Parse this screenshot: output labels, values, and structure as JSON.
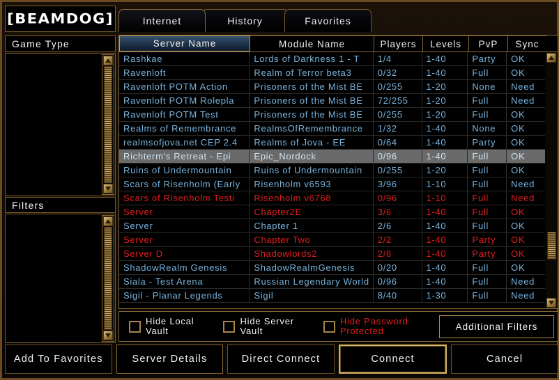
{
  "brand": {
    "logo_text": "[BEAMDOG]"
  },
  "tabs": [
    {
      "label": "Internet",
      "active": true
    },
    {
      "label": "History",
      "active": false
    },
    {
      "label": "Favorites",
      "active": false
    }
  ],
  "sidebar": {
    "game_type_title": "Game Type",
    "filters_title": "Filters"
  },
  "table": {
    "columns": [
      {
        "key": "name",
        "label": "Server Name",
        "sorted": true
      },
      {
        "key": "module",
        "label": "Module Name",
        "sorted": false
      },
      {
        "key": "players",
        "label": "Players",
        "sorted": false
      },
      {
        "key": "levels",
        "label": "Levels",
        "sorted": false
      },
      {
        "key": "pvp",
        "label": "PvP",
        "sorted": false
      },
      {
        "key": "sync",
        "label": "Sync",
        "sorted": false
      }
    ],
    "rows": [
      {
        "name": "Rashkae",
        "module": "Lords of Darkness 1 - T",
        "players": "1/4",
        "levels": "1-40",
        "pvp": "Party",
        "sync": "OK",
        "red": false,
        "selected": false
      },
      {
        "name": "Ravenloft",
        "module": "Realm of Terror beta3",
        "players": "0/32",
        "levels": "1-40",
        "pvp": "Full",
        "sync": "OK",
        "red": false,
        "selected": false
      },
      {
        "name": "Ravenloft POTM Action",
        "module": "Prisoners of the Mist BE",
        "players": "0/255",
        "levels": "1-20",
        "pvp": "None",
        "sync": "Need",
        "red": false,
        "selected": false
      },
      {
        "name": "Ravenloft POTM Rolepla",
        "module": "Prisoners of the Mist BE",
        "players": "72/255",
        "levels": "1-20",
        "pvp": "Full",
        "sync": "Need",
        "red": false,
        "selected": false
      },
      {
        "name": "Ravenloft POTM Test",
        "module": "Prisoners of the Mist BE",
        "players": "0/255",
        "levels": "1-20",
        "pvp": "Full",
        "sync": "OK",
        "red": false,
        "selected": false
      },
      {
        "name": "Realms of Remembrance",
        "module": "RealmsOfRemembrance",
        "players": "1/32",
        "levels": "1-40",
        "pvp": "None",
        "sync": "OK",
        "red": false,
        "selected": false
      },
      {
        "name": "realmsofjova.net CEP 2.4",
        "module": "Realms of Jova - EE",
        "players": "0/64",
        "levels": "1-40",
        "pvp": "Party",
        "sync": "OK",
        "red": false,
        "selected": false
      },
      {
        "name": "Richterm's Retreat - Epi",
        "module": "Epic_Nordock",
        "players": "0/96",
        "levels": "1-40",
        "pvp": "Full",
        "sync": "OK",
        "red": false,
        "selected": true
      },
      {
        "name": "Ruins of Undermountain",
        "module": "Ruins of Undermountain",
        "players": "0/255",
        "levels": "1-20",
        "pvp": "Full",
        "sync": "OK",
        "red": false,
        "selected": false
      },
      {
        "name": "Scars of Risenholm (Early",
        "module": "Risenholm v6593",
        "players": "3/96",
        "levels": "1-10",
        "pvp": "Full",
        "sync": "Need",
        "red": false,
        "selected": false
      },
      {
        "name": "Scars of Risenholm Testi",
        "module": "Risenholm v6768",
        "players": "0/96",
        "levels": "1-10",
        "pvp": "Full",
        "sync": "Need",
        "red": true,
        "selected": false
      },
      {
        "name": "Server",
        "module": "Chapter2E",
        "players": "3/6",
        "levels": "1-40",
        "pvp": "Full",
        "sync": "OK",
        "red": true,
        "selected": false
      },
      {
        "name": "Server",
        "module": "Chapter 1",
        "players": "2/6",
        "levels": "1-40",
        "pvp": "Full",
        "sync": "OK",
        "red": false,
        "selected": false
      },
      {
        "name": "Server",
        "module": "Chapter Two",
        "players": "2/2",
        "levels": "1-40",
        "pvp": "Party",
        "sync": "OK",
        "red": true,
        "selected": false
      },
      {
        "name": "Server D",
        "module": "Shadowlords2",
        "players": "2/6",
        "levels": "1-40",
        "pvp": "Party",
        "sync": "OK",
        "red": true,
        "selected": false
      },
      {
        "name": "ShadowRealm Genesis",
        "module": "ShadowRealmGenesis",
        "players": "0/20",
        "levels": "1-40",
        "pvp": "Full",
        "sync": "OK",
        "red": false,
        "selected": false
      },
      {
        "name": "Siala - Test Arena",
        "module": "Russian Legendary World",
        "players": "0/96",
        "levels": "1-40",
        "pvp": "Full",
        "sync": "Need",
        "red": false,
        "selected": false
      },
      {
        "name": "Sigil - Planar Legends",
        "module": "Sigil",
        "players": "8/40",
        "levels": "1-30",
        "pvp": "Full",
        "sync": "Need",
        "red": false,
        "selected": false
      }
    ]
  },
  "filters": {
    "checkboxes": [
      {
        "label": "Hide Local\nVault",
        "red": false,
        "checked": false
      },
      {
        "label": "Hide Server\nVault",
        "red": false,
        "checked": false
      },
      {
        "label": "Hide Password\nProtected",
        "red": true,
        "checked": false
      }
    ],
    "additional_button": "Additional Filters"
  },
  "buttons": [
    {
      "label": "Add To Favorites",
      "emph": false
    },
    {
      "label": "Server Details",
      "emph": false
    },
    {
      "label": "Direct Connect",
      "emph": false
    },
    {
      "label": "Connect",
      "emph": true
    },
    {
      "label": "Cancel",
      "emph": false
    }
  ],
  "colors": {
    "text_blue": "#79b3dd",
    "text_red": "#e11d1d",
    "gold_border": "#8a6a34",
    "sorted_header": "#35506e",
    "selected_row": "#6a6a6a"
  },
  "icons": {
    "scroll_up": "scroll-up-arrow-icon",
    "scroll_down": "scroll-down-arrow-icon"
  }
}
